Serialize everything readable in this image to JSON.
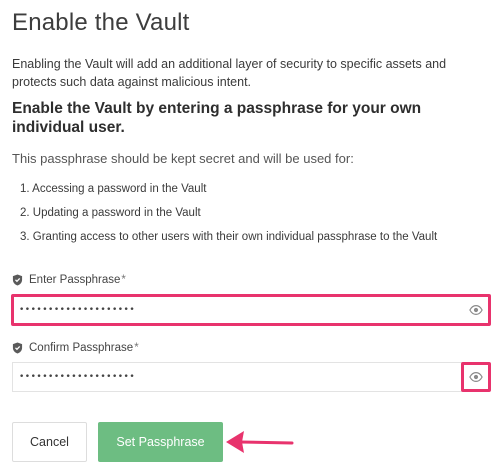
{
  "page": {
    "title": "Enable the Vault",
    "intro": "Enabling the Vault will add an additional layer of security to specific assets and protects such data against malicious intent.",
    "subtitle": "Enable the Vault by entering a passphrase for your own individual user.",
    "lead": "This passphrase should be kept secret and will be used for:",
    "steps": [
      "1. Accessing a password in the Vault",
      "2. Updating a password in the Vault",
      "3. Granting access to other users with their own individual passphrase to the Vault"
    ]
  },
  "form": {
    "passphrase": {
      "label": "Enter Passphrase",
      "required_mark": "*",
      "value": "••••••••••••••••••••"
    },
    "confirm": {
      "label": "Confirm Passphrase",
      "required_mark": "*",
      "value": "••••••••••••••••••••"
    }
  },
  "actions": {
    "cancel_label": "Cancel",
    "submit_label": "Set Passphrase"
  },
  "colors": {
    "accent": "#6dbd82",
    "highlight": "#e8336d"
  },
  "icons": {
    "field_icon": "shield-icon",
    "toggle_icon": "eye-icon",
    "annotation": "arrow-icon"
  }
}
